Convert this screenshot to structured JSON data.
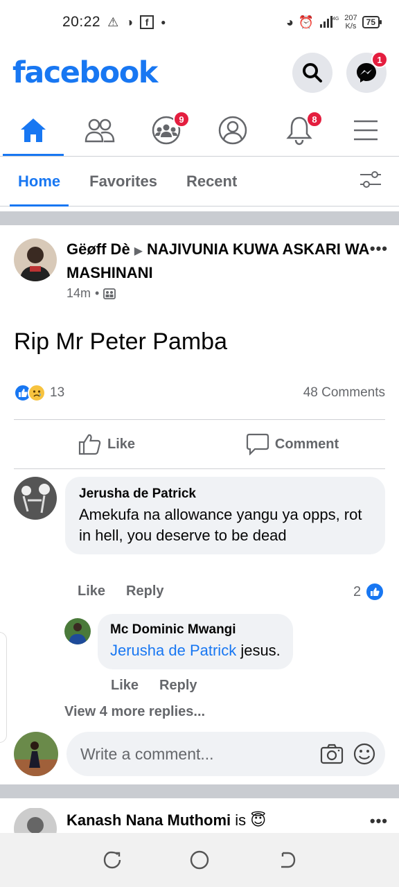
{
  "status_bar": {
    "time": "20:22",
    "net_speed_value": "207",
    "net_speed_unit": "K/s",
    "battery": "75"
  },
  "header": {
    "logo": "facebook",
    "messenger_badge": "1"
  },
  "tabs": [
    {
      "name": "home",
      "icon": "home-icon",
      "active": true
    },
    {
      "name": "friends",
      "icon": "friends-icon"
    },
    {
      "name": "groups",
      "icon": "groups-icon",
      "badge": "9"
    },
    {
      "name": "profile",
      "icon": "profile-icon"
    },
    {
      "name": "notifications",
      "icon": "bell-icon",
      "badge": "8"
    },
    {
      "name": "menu",
      "icon": "menu-icon"
    }
  ],
  "feed_filter": {
    "home": "Home",
    "favorites": "Favorites",
    "recent": "Recent"
  },
  "post": {
    "author": "Gëøff Dè",
    "group": "NAJIVUNIA KUWA ASKARI  WA MASHINANI",
    "time": "14m",
    "text": "Rip Mr Peter Pamba",
    "reaction_count": "13",
    "comments_count": "48 Comments",
    "like_label": "Like",
    "comment_label": "Comment"
  },
  "comments": [
    {
      "name": "Jerusha de Patrick",
      "text": "Amekufa na allowance yangu ya opps,  rot in hell,  you deserve to be dead",
      "like_label": "Like",
      "reply_label": "Reply",
      "likes": "2"
    },
    {
      "name": "Mc Dominic Mwangi",
      "mention": "Jerusha de Patrick",
      "text": " jesus.",
      "like_label": "Like",
      "reply_label": "Reply"
    }
  ],
  "view_more": "View 4 more replies...",
  "write_comment_placeholder": "Write a comment...",
  "next_post": {
    "author": "Kanash Nana Muthomi",
    "suffix": "is"
  },
  "colors": {
    "brand": "#1877f2",
    "badge": "#e41e3f",
    "muted": "#65676b"
  }
}
